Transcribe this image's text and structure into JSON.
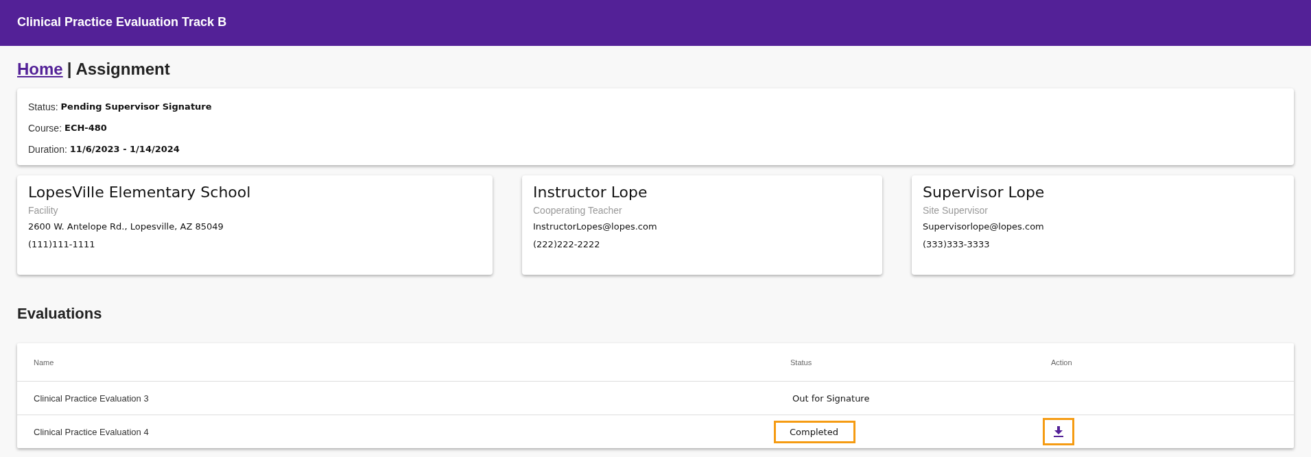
{
  "header": {
    "title": "Clinical Practice Evaluation Track B"
  },
  "breadcrumb": {
    "link": "Home",
    "separator": "|",
    "current": "Assignment"
  },
  "summary": [
    {
      "label": "Status:",
      "value": "Pending Supervisor Signature"
    },
    {
      "label": "Course:",
      "value": "ECH-480"
    },
    {
      "label": "Duration:",
      "value": "11/6/2023 - 1/14/2024"
    }
  ],
  "contacts": [
    {
      "name": "LopesVille Elementary School",
      "role": "Facility",
      "line_1": "2600 W. Antelope Rd., Lopesville, AZ 85049",
      "line_2": "(111)111-1111"
    },
    {
      "name": "Instructor Lope",
      "role": "Cooperating Teacher",
      "line_1": "InstructorLopes@lopes.com",
      "line_2": "(222)222-2222"
    },
    {
      "name": "Supervisor Lope",
      "role": "Site Supervisor",
      "line_1": "Supervisorlope@lopes.com",
      "line_2": "(333)333-3333"
    }
  ],
  "evaluations": {
    "title": "Evaluations",
    "columns": [
      "Name",
      "Status",
      "Action"
    ],
    "rows": [
      {
        "name": "Clinical Practice Evaluation 3",
        "status": "Out for Signature",
        "status_highlighted": false,
        "download": false
      },
      {
        "name": "Clinical Practice Evaluation 4",
        "status": "Completed",
        "status_highlighted": true,
        "download": true,
        "download_highlighted": true
      }
    ]
  }
}
